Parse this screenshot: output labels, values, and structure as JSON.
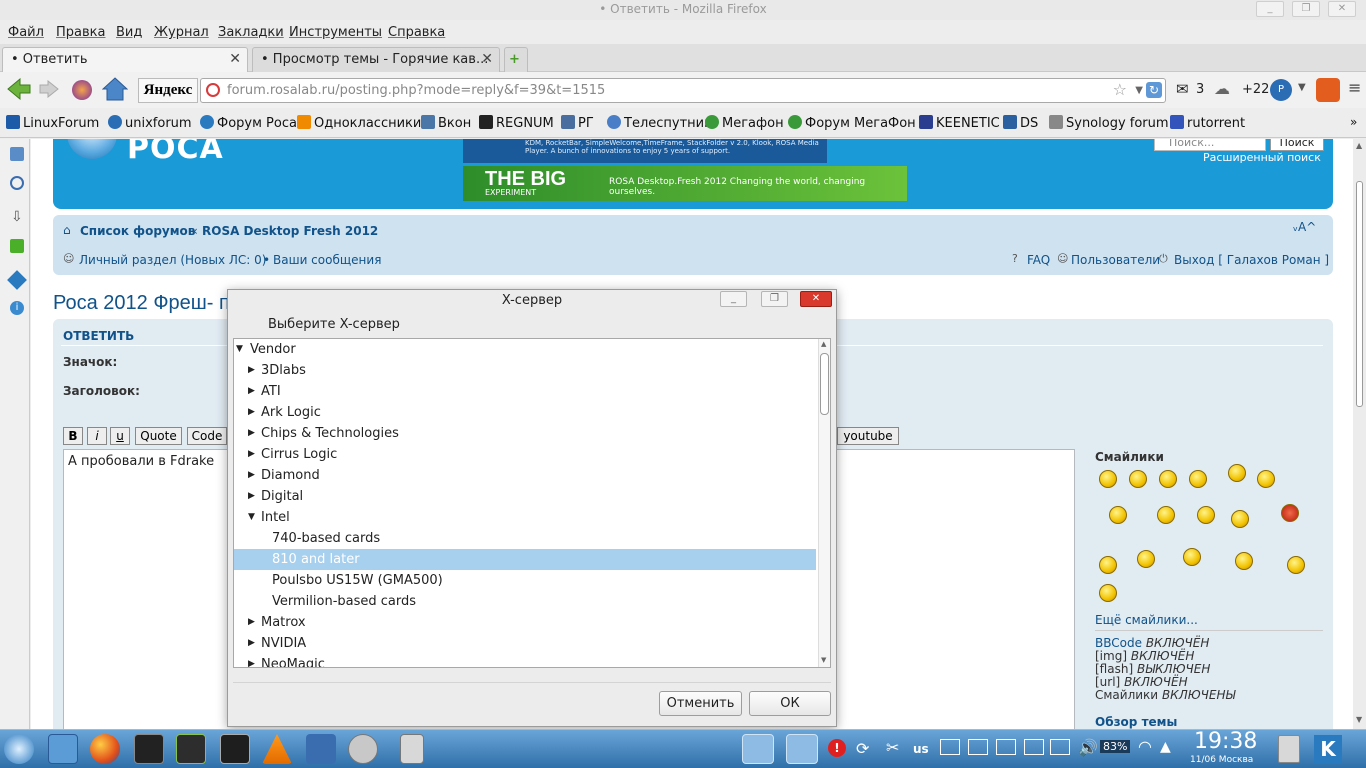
{
  "window": {
    "title": "• Ответить - Mozilla Firefox",
    "controls": [
      "_",
      "❐",
      "✕"
    ]
  },
  "menubar": {
    "items": [
      "Файл",
      "Правка",
      "Вид",
      "Журнал",
      "Закладки",
      "Инструменты",
      "Справка"
    ]
  },
  "tabs": [
    {
      "label": "• Ответить",
      "active": true
    },
    {
      "label": "• Просмотр темы - Горячие кав...",
      "active": false
    }
  ],
  "tab_new_label": "+",
  "navbar": {
    "yandex_label": "Яндекс",
    "url": "forum.rosalab.ru/posting.php?mode=reply&f=39&t=1515",
    "mail_count": "3",
    "weather": "+22"
  },
  "bookmarks": [
    {
      "label": "LinuxForum",
      "color": "#1d5aa8"
    },
    {
      "label": "unixforum",
      "color": "#2a6db5"
    },
    {
      "label": "Форум Роса",
      "color": "#2a7ac0"
    },
    {
      "label": "Одноклассники",
      "color": "#f08a00"
    },
    {
      "label": "Вкон",
      "color": "#4a76a8"
    },
    {
      "label": "REGNUM",
      "color": "#222222"
    },
    {
      "label": "РГ",
      "color": "#4a6da0"
    },
    {
      "label": "Телеспутник",
      "color": "#4a7fc8"
    },
    {
      "label": "Мегафон",
      "color": "#3a9a3a"
    },
    {
      "label": "Форум МегаФон",
      "color": "#3a9a3a"
    },
    {
      "label": "KEENETIC",
      "color": "#2b3d8f"
    },
    {
      "label": "DS",
      "color": "#2a5fa0"
    },
    {
      "label": "Synology forum",
      "color": "#888888"
    },
    {
      "label": "rutorrent",
      "color": "#3355bb"
    }
  ],
  "page": {
    "logo_text": "РОСА",
    "banner_small": "KDM, RocketBar, SimpleWelcome,TimeFrame, StackFolder v 2.0, Klook, ROSA Media Player. A bunch of innovations to enjoy 5 years of support.",
    "banner_big_title": "THE BIG",
    "banner_big_sub": "EXPERIMENT",
    "banner_big_text": "ROSA Desktop.Fresh 2012 Changing the world, changing ourselves.",
    "search_placeholder": "Поиск...",
    "search_button": "Поиск",
    "advanced_search": "Расширенный поиск",
    "breadcrumb": [
      "Список форумов",
      "ROSA Desktop Fresh 2012"
    ],
    "breadcrumb_sep": "‹",
    "font_resize": "ᵥA^",
    "pm_link": "Личный раздел (Новых ЛС: 0)",
    "my_posts": "Ваши сообщения",
    "faq": "FAQ",
    "users": "Пользователи",
    "logout": "Выход [ Галахов Роман ]",
    "post_title": "Роса 2012 Фреш- пр",
    "reply_heading": "ОТВЕТИТЬ",
    "icon_label": "Значок:",
    "subject_label": "Заголовок:",
    "format_buttons": [
      "B",
      "i",
      "u",
      "Quote",
      "Code"
    ],
    "youtube_button": "youtube",
    "textarea_text": "А пробовали в Fdrake",
    "smilies_heading": "Смайлики",
    "more_smilies": "Ещё смайлики...",
    "status_lines": [
      {
        "k": "BBCode",
        "v": "ВКЛЮЧЁН"
      },
      {
        "k": "[img]",
        "v": "ВКЛЮЧЁН"
      },
      {
        "k": "[flash]",
        "v": "ВЫКЛЮЧЕН"
      },
      {
        "k": "[url]",
        "v": "ВКЛЮЧЁН"
      },
      {
        "k": "Смайлики",
        "v": "ВКЛЮЧЕНЫ"
      }
    ],
    "topic_review": "Обзор темы"
  },
  "dialog": {
    "title": "X-сервер",
    "label": "Выберите X-сервер",
    "tree": [
      {
        "label": "Vendor",
        "level": 0,
        "expanded": true
      },
      {
        "label": "3Dlabs",
        "level": 1,
        "expanded": false
      },
      {
        "label": "ATI",
        "level": 1,
        "expanded": false
      },
      {
        "label": "Ark Logic",
        "level": 1,
        "expanded": false
      },
      {
        "label": "Chips & Technologies",
        "level": 1,
        "expanded": false
      },
      {
        "label": "Cirrus Logic",
        "level": 1,
        "expanded": false
      },
      {
        "label": "Diamond",
        "level": 1,
        "expanded": false
      },
      {
        "label": "Digital",
        "level": 1,
        "expanded": false
      },
      {
        "label": "Intel",
        "level": 1,
        "expanded": true
      },
      {
        "label": "740-based cards",
        "level": 2,
        "selected": false
      },
      {
        "label": "810 and later",
        "level": 2,
        "selected": true
      },
      {
        "label": "Poulsbo US15W (GMA500)",
        "level": 2,
        "selected": false
      },
      {
        "label": "Vermilion-based cards",
        "level": 2,
        "selected": false
      },
      {
        "label": "Matrox",
        "level": 1,
        "expanded": false
      },
      {
        "label": "NVIDIA",
        "level": 1,
        "expanded": false
      },
      {
        "label": "NeoMagic",
        "level": 1,
        "expanded": false
      }
    ],
    "cancel": "Отменить",
    "ok": "ОК"
  },
  "taskbar": {
    "layout": "us",
    "battery": "83%",
    "time": "19:38",
    "date": "11/06 Москва"
  }
}
